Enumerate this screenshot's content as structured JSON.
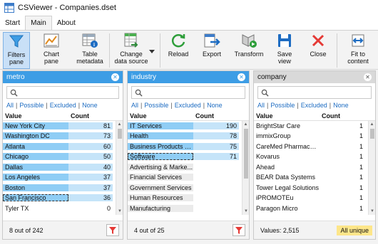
{
  "window": {
    "title": "CSViewer - Companies.dset"
  },
  "tabs": [
    {
      "label": "Start"
    },
    {
      "label": "Main",
      "active": true
    },
    {
      "label": "About"
    }
  ],
  "ribbon": {
    "filters_pane": "Filters\npane",
    "chart_pane": "Chart\npane",
    "table_metadata": "Table\nmetadata",
    "change_data_source": "Change\ndata source",
    "reload": "Reload",
    "export": "Export",
    "transform": "Transform",
    "save_view": "Save\nview",
    "close": "Close",
    "fit_to_content": "Fit to\ncontent"
  },
  "filter_links": {
    "all": "All",
    "possible": "Possible",
    "excluded": "Excluded",
    "none": "None"
  },
  "columns": {
    "value": "Value",
    "count": "Count"
  },
  "panels": [
    {
      "title": "metro",
      "selected": true,
      "rows": [
        {
          "value": "New York City",
          "count": "81",
          "state": "hl"
        },
        {
          "value": "Washington DC",
          "count": "73",
          "state": "hl"
        },
        {
          "value": "Atlanta",
          "count": "60",
          "state": "hl"
        },
        {
          "value": "Chicago",
          "count": "50",
          "state": "hl"
        },
        {
          "value": "Dallas",
          "count": "40",
          "state": "hl"
        },
        {
          "value": "Los Angeles",
          "count": "37",
          "state": "hl"
        },
        {
          "value": "Boston",
          "count": "37",
          "state": "hl"
        },
        {
          "value": "San Francisco",
          "count": "36",
          "state": "hl focus"
        },
        {
          "value": "Tyler TX",
          "count": "0",
          "state": ""
        }
      ],
      "footer": "8 out of 242",
      "has_filter_button": true
    },
    {
      "title": "industry",
      "selected": true,
      "rows": [
        {
          "value": "IT Services",
          "count": "190",
          "state": "hl"
        },
        {
          "value": "Health",
          "count": "78",
          "state": "hl"
        },
        {
          "value": "Business Products &...",
          "count": "75",
          "state": "hl"
        },
        {
          "value": "Software",
          "count": "71",
          "state": "hl focus"
        },
        {
          "value": "Advertising & Marke...",
          "count": "",
          "state": "ex"
        },
        {
          "value": "Financial Services",
          "count": "",
          "state": "ex"
        },
        {
          "value": "Government Services",
          "count": "",
          "state": "ex"
        },
        {
          "value": "Human Resources",
          "count": "",
          "state": "ex"
        },
        {
          "value": "Manufacturing",
          "count": "",
          "state": "ex"
        }
      ],
      "footer": "4 out of 25",
      "has_filter_button": true
    },
    {
      "title": "company",
      "selected": false,
      "rows": [
        {
          "value": "BrightStar Care",
          "count": "1",
          "state": ""
        },
        {
          "value": "immixGroup",
          "count": "1",
          "state": ""
        },
        {
          "value": "CareMed Pharmaceu...",
          "count": "1",
          "state": ""
        },
        {
          "value": "Kovarus",
          "count": "1",
          "state": ""
        },
        {
          "value": "Ahead",
          "count": "1",
          "state": ""
        },
        {
          "value": "BEAR Data Systems",
          "count": "1",
          "state": ""
        },
        {
          "value": "Tower Legal Solutions",
          "count": "1",
          "state": ""
        },
        {
          "value": "iPROMOTEu",
          "count": "1",
          "state": ""
        },
        {
          "value": "Paragon Micro",
          "count": "1",
          "state": ""
        }
      ],
      "footer": "Values: 2,515",
      "badge": "All unique",
      "has_filter_button": false
    }
  ],
  "colors": {
    "accent": "#3d9de5",
    "highlight": "#8fcdf5",
    "badge": "#fde68a"
  }
}
